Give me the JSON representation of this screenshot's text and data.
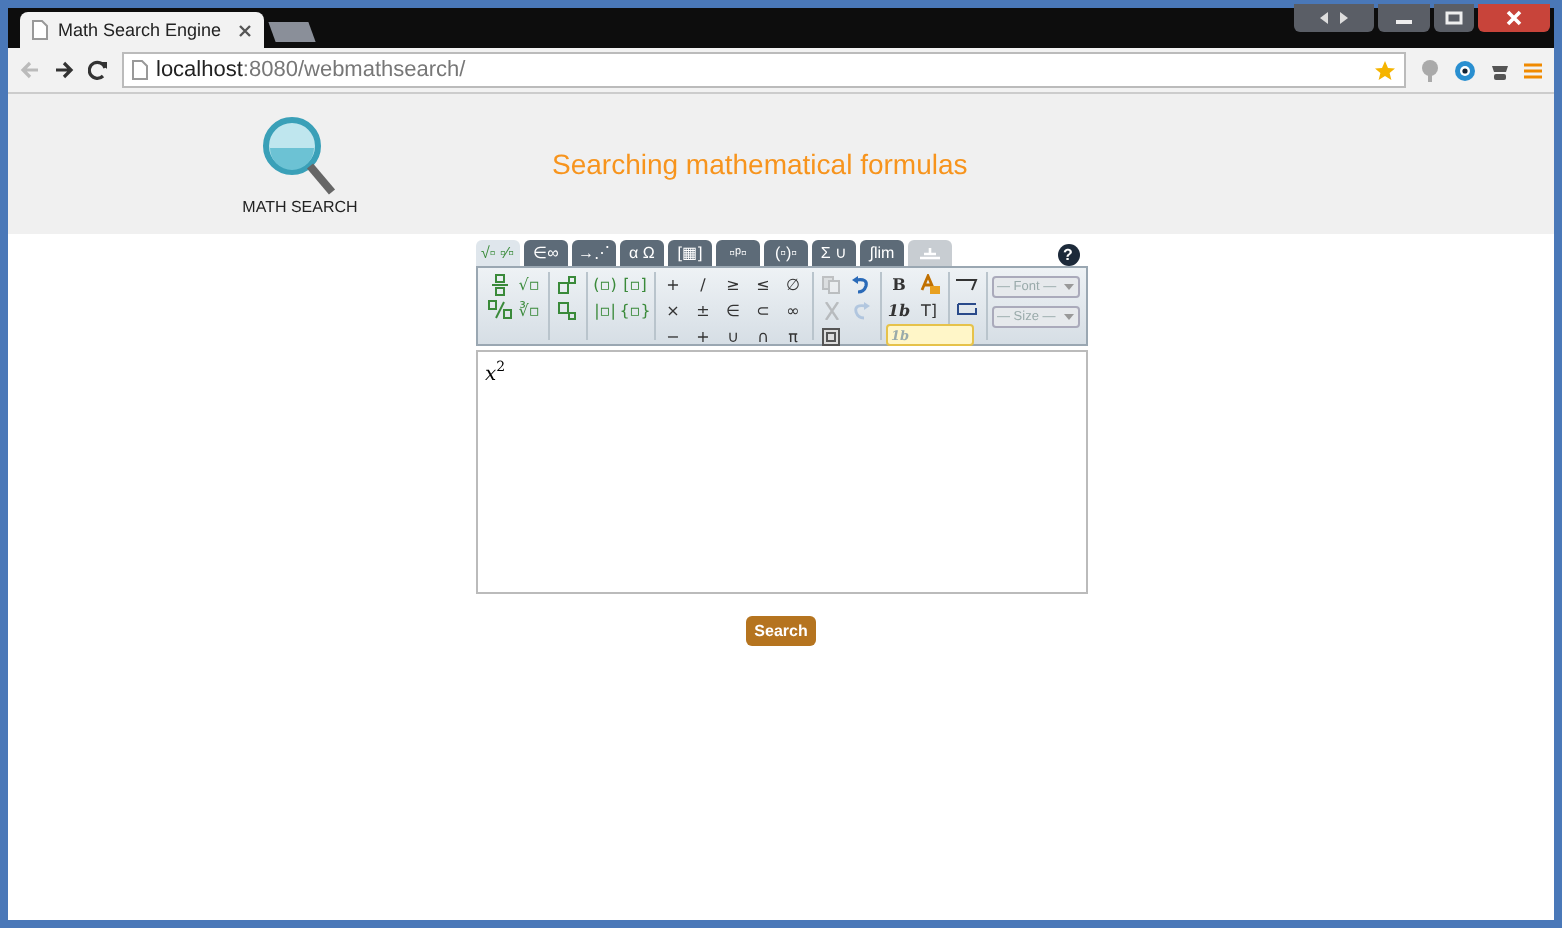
{
  "browser": {
    "tab_title": "Math Search Engine",
    "url_host": "localhost",
    "url_rest": ":8080/webmathsearch/"
  },
  "header": {
    "logo_text": "MATH SEARCH",
    "title": "Searching mathematical formulas"
  },
  "editor": {
    "tabs": [
      {
        "label": "√▫ ▫⁄▫",
        "selected": true,
        "disabled": false
      },
      {
        "label": "∈∞",
        "selected": false,
        "disabled": false
      },
      {
        "label": "→⋰",
        "selected": false,
        "disabled": false
      },
      {
        "label": "α Ω",
        "selected": false,
        "disabled": false
      },
      {
        "label": "[▦]",
        "selected": false,
        "disabled": false
      },
      {
        "label": "▫ᵖ▫",
        "selected": false,
        "disabled": false
      },
      {
        "label": "(▫)▫",
        "selected": false,
        "disabled": false
      },
      {
        "label": "Σ ∪",
        "selected": false,
        "disabled": false
      },
      {
        "label": "∫lim",
        "selected": false,
        "disabled": false
      },
      {
        "kind": "icon",
        "selected": false,
        "disabled": true
      }
    ],
    "help_label": "?",
    "groups": [
      {
        "items": [
          {
            "kind": "fraction",
            "disabled": false,
            "selected": false
          },
          {
            "kind": "text",
            "label": "√▫",
            "disabled": false,
            "selected": false
          },
          {
            "kind": "slash",
            "disabled": false,
            "selected": false
          },
          {
            "kind": "text",
            "label": "∛▫",
            "disabled": false,
            "selected": false
          }
        ]
      },
      {
        "items": [
          {
            "kind": "superscript",
            "disabled": false,
            "selected": false
          },
          {
            "kind": "subscript",
            "disabled": false,
            "selected": false
          }
        ]
      },
      {
        "items": [
          {
            "kind": "text",
            "label": "(▫)",
            "disabled": false,
            "selected": false
          },
          {
            "kind": "text",
            "label": "[▫]",
            "disabled": false,
            "selected": false
          },
          {
            "kind": "text",
            "label": "|▫|",
            "disabled": false,
            "selected": false
          },
          {
            "kind": "text",
            "label": "{▫}",
            "disabled": false,
            "selected": false
          }
        ]
      },
      {
        "items": [
          {
            "kind": "text",
            "label": "+",
            "disabled": false,
            "selected": false
          },
          {
            "kind": "text",
            "label": "/",
            "disabled": false,
            "selected": false
          },
          {
            "kind": "text",
            "label": "≥",
            "disabled": false,
            "selected": false
          },
          {
            "kind": "text",
            "label": "≤",
            "disabled": false,
            "selected": false
          },
          {
            "kind": "text",
            "label": "∅",
            "disabled": false,
            "selected": false
          },
          {
            "kind": "text",
            "label": "×",
            "disabled": false,
            "selected": false
          },
          {
            "kind": "text",
            "label": "±",
            "disabled": false,
            "selected": false
          },
          {
            "kind": "text",
            "label": "∈",
            "disabled": false,
            "selected": false
          },
          {
            "kind": "text",
            "label": "⊂",
            "disabled": false,
            "selected": false
          },
          {
            "kind": "text",
            "label": "∞",
            "disabled": false,
            "selected": false
          },
          {
            "kind": "text",
            "label": "−",
            "disabled": false,
            "selected": false
          },
          {
            "kind": "text",
            "label": "+",
            "disabled": false,
            "selected": false
          },
          {
            "kind": "text",
            "label": "∪",
            "disabled": false,
            "selected": false
          },
          {
            "kind": "text",
            "label": "∩",
            "disabled": false,
            "selected": false
          },
          {
            "kind": "text",
            "label": "π",
            "disabled": false,
            "selected": false
          }
        ]
      },
      {
        "items": [
          {
            "kind": "copy",
            "disabled": true,
            "selected": false
          },
          {
            "kind": "undo",
            "disabled": false,
            "selected": false
          },
          {
            "kind": "cut",
            "disabled": true,
            "selected": false
          },
          {
            "kind": "redo",
            "disabled": true,
            "selected": false
          },
          {
            "kind": "box",
            "disabled": false,
            "selected": false
          }
        ]
      },
      {
        "items": [
          {
            "kind": "bold",
            "label": "B",
            "disabled": false,
            "selected": false
          },
          {
            "kind": "color",
            "disabled": false,
            "selected": false
          },
          {
            "kind": "italic",
            "label": "1b",
            "disabled": false,
            "selected": false
          },
          {
            "kind": "text",
            "label": "T]",
            "disabled": false,
            "selected": false
          },
          {
            "kind": "italic",
            "label": "1b",
            "disabled": false,
            "selected": true
          }
        ]
      },
      {
        "items": [
          {
            "kind": "flip",
            "disabled": false,
            "selected": false
          },
          {
            "kind": "wrap",
            "disabled": false,
            "selected": false
          }
        ]
      }
    ],
    "selects": [
      {
        "label": "— Font —",
        "disabled": true
      },
      {
        "label": "— Size —",
        "disabled": true
      }
    ],
    "formula": {
      "base": "x",
      "sup": "2"
    }
  },
  "search_button": "Search"
}
